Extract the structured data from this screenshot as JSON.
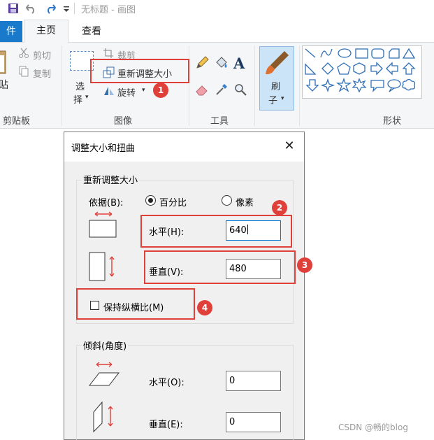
{
  "window": {
    "title": "无标题 - 画图"
  },
  "tabs": {
    "file": "件",
    "home": "主页",
    "view": "查看"
  },
  "ribbon": {
    "clipboard": {
      "paste": "贴",
      "cut": "剪切",
      "copy": "复制",
      "label": "剪贴板"
    },
    "image": {
      "select_line1": "选",
      "select_line2": "择",
      "crop": "裁剪",
      "resize": "重新调整大小",
      "rotate": "旋转",
      "label": "图像"
    },
    "tools": {
      "label": "工具"
    },
    "brushes": {
      "line1": "刷",
      "line2": "子"
    },
    "shapes": {
      "label": "形状"
    }
  },
  "annotations": [
    "1",
    "2",
    "3",
    "4"
  ],
  "dialog": {
    "title": "调整大小和扭曲",
    "close_glyph": "✕",
    "resize_section": {
      "legend": "重新调整大小",
      "by_label": "依据(B):",
      "percentage": "百分比",
      "pixels": "像素",
      "selected": "percentage",
      "horizontal_label": "水平(H):",
      "horizontal_value": "640",
      "vertical_label": "垂直(V):",
      "vertical_value": "480",
      "keep_ratio_label": "保持纵横比(M)",
      "keep_ratio_checked": false
    },
    "skew_section": {
      "legend": "倾斜(角度)",
      "horizontal_label": "水平(O):",
      "horizontal_value": "0",
      "vertical_label": "垂直(E):",
      "vertical_value": "0"
    }
  },
  "watermark": "CSDN @畅的blog",
  "colors": {
    "accent": "#1979ca",
    "annotation": "#e0403a",
    "dialog_bg": "#f0f0f0",
    "ribbon_bg": "#f5f6f7"
  }
}
